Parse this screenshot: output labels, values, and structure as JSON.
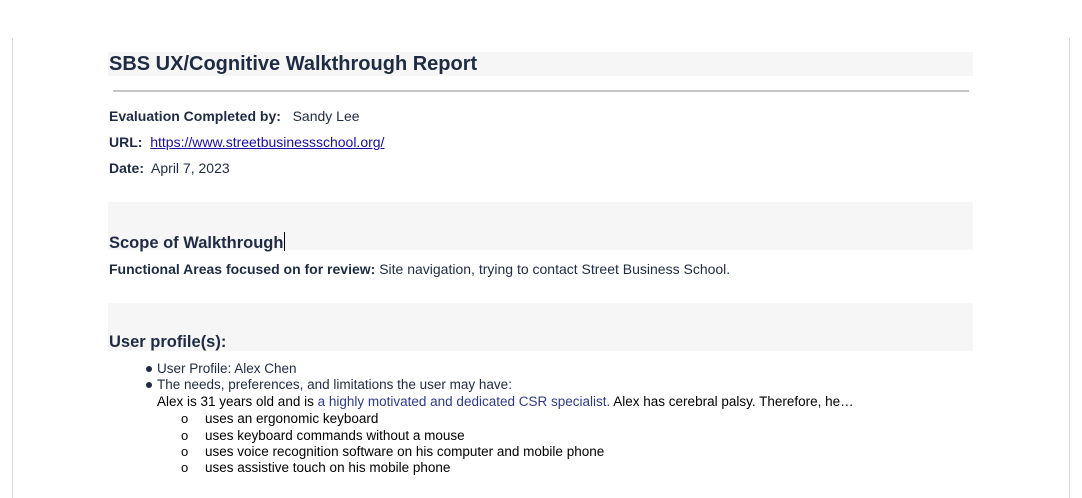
{
  "report": {
    "title": "SBS UX/Cognitive Walkthrough Report",
    "evaluation_label": "Evaluation Completed by:",
    "evaluator": "Sandy Lee",
    "url_label": "URL:",
    "url": "https://www.streetbusinessschool.org/",
    "date_label": "Date:",
    "date": "April 7, 2023"
  },
  "scope": {
    "heading": "Scope of Walkthrough",
    "functional_label": "Functional Areas focused on for review:",
    "functional_text": "Site navigation, trying to contact Street Business School."
  },
  "user_profiles": {
    "heading": "User profile(s):",
    "bullet_1": "User Profile: Alex Chen",
    "bullet_2": "The needs, preferences, and limitations the user may have:",
    "description_part1": "Alex is 31 years old and is ",
    "description_part2": "a highly motivated and dedicated CSR specialist.",
    "description_part3": " Alex has cerebral palsy. Therefore, he…",
    "sub_marker": "o",
    "sub_items": [
      "uses an ergonomic keyboard",
      "uses keyboard commands without a mouse",
      "uses voice recognition software on his computer and mobile phone",
      "uses assistive touch on his mobile phone"
    ]
  }
}
